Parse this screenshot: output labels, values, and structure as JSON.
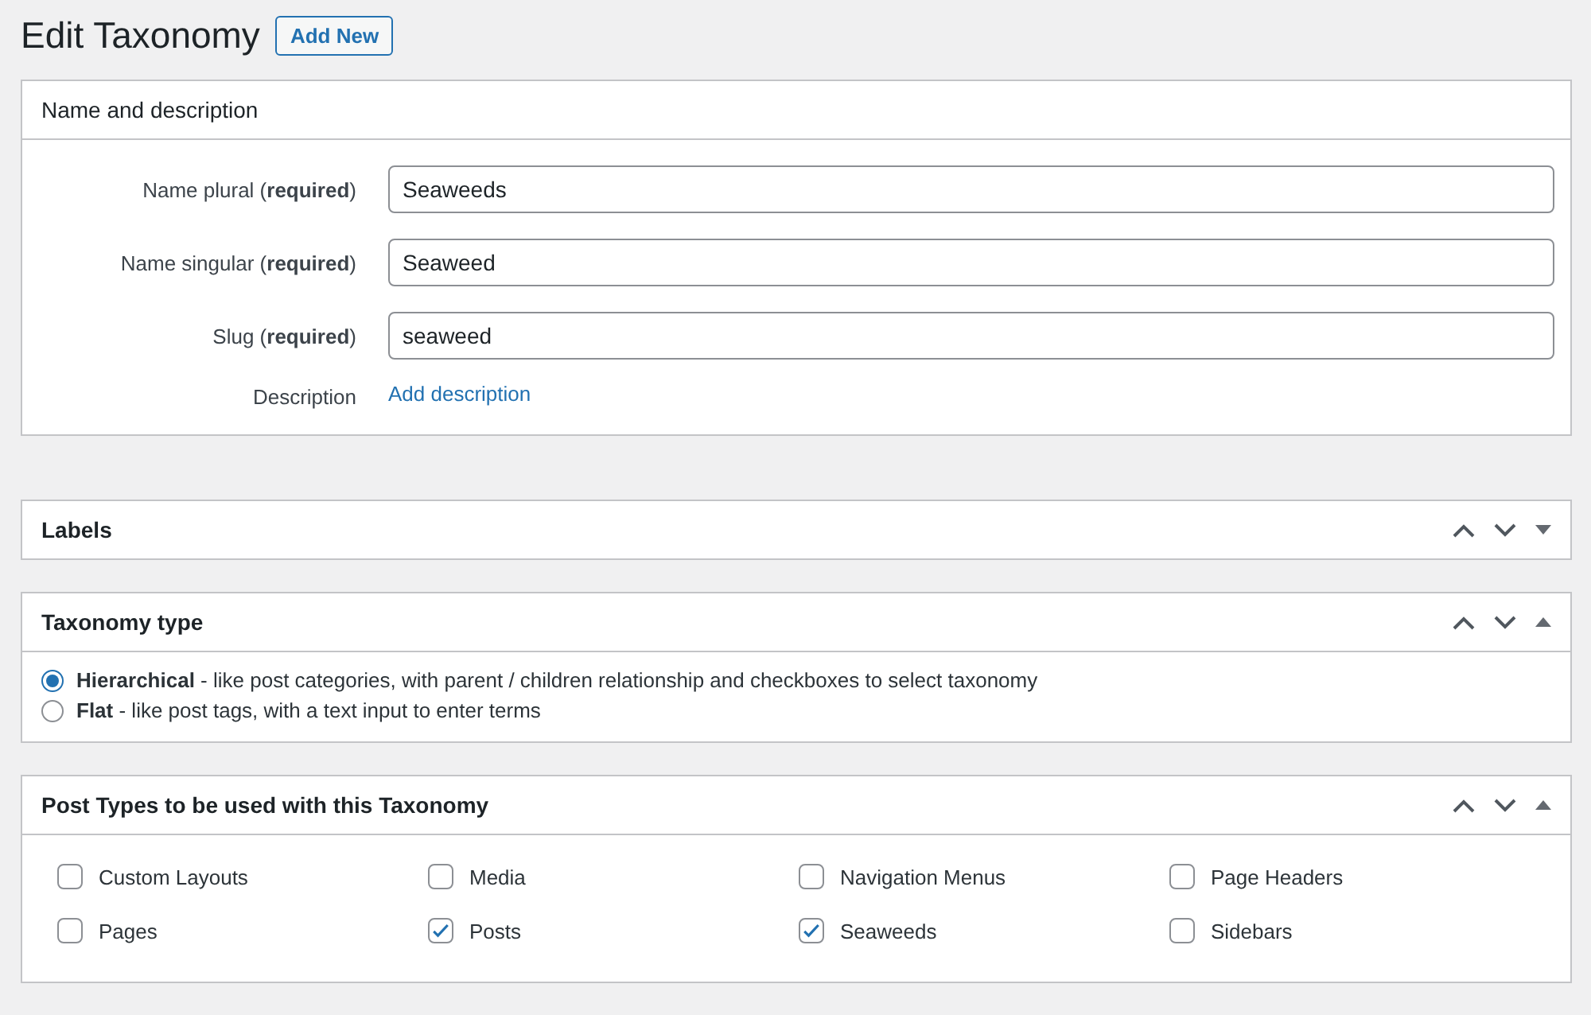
{
  "page_title": "Edit Taxonomy",
  "add_new_button": "Add New",
  "panels": [
    {
      "kind": "fields",
      "title": "Name and description",
      "fields": [
        {
          "kind": "input",
          "label": "Name plural (**required**)",
          "value": "Seaweeds"
        },
        {
          "kind": "input",
          "label": "Name singular (**required**)",
          "value": "Seaweed"
        },
        {
          "kind": "input",
          "label": "Slug (**required**)",
          "value": "seaweed"
        },
        {
          "kind": "link",
          "label": "Description",
          "value": "Add description"
        }
      ]
    },
    {
      "kind": "empty",
      "title": "Labels",
      "expanded": false
    },
    {
      "kind": "radios",
      "title": "Taxonomy type",
      "expanded": true,
      "options": [
        {
          "label": "**Hierarchical** - like post categories, with parent / children relationship and checkboxes to select taxonomy",
          "selected": true
        },
        {
          "label": "**Flat** - like post tags, with a text input to enter terms",
          "selected": false
        }
      ]
    },
    {
      "kind": "checkboxes",
      "title": "Post Types to be used with this Taxonomy",
      "expanded": true,
      "options": [
        {
          "label": "Custom Layouts",
          "checked": false
        },
        {
          "label": "Media",
          "checked": false
        },
        {
          "label": "Navigation Menus",
          "checked": false
        },
        {
          "label": "Page Headers",
          "checked": false
        },
        {
          "label": "Pages",
          "checked": false
        },
        {
          "label": "Posts",
          "checked": true
        },
        {
          "label": "Seaweeds",
          "checked": true
        },
        {
          "label": "Sidebars",
          "checked": false
        }
      ]
    }
  ]
}
